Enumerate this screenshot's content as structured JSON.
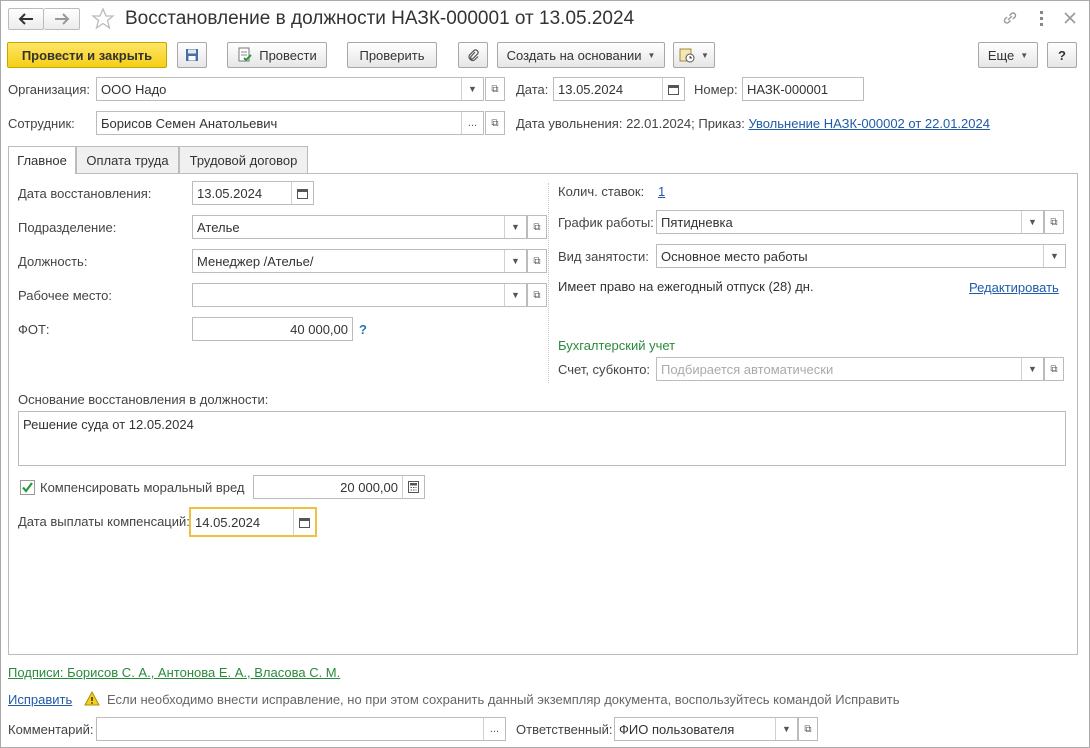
{
  "title": "Восстановление в должности НАЗК-000001 от 13.05.2024",
  "toolbar": {
    "post_close": "Провести и закрыть",
    "post": "Провести",
    "check": "Проверить",
    "create_based": "Создать на основании",
    "more": "Еще",
    "help": "?"
  },
  "header": {
    "org_label": "Организация:",
    "org_value": "ООО Надо",
    "date_label": "Дата:",
    "date_value": "13.05.2024",
    "number_label": "Номер:",
    "number_value": "НАЗК-000001",
    "employee_label": "Сотрудник:",
    "employee_value": "Борисов Семен Анатольевич",
    "dismissal_text": "Дата увольнения: 22.01.2024; Приказ:",
    "dismissal_link": "Увольнение НАЗК-000002 от 22.01.2024"
  },
  "tabs": [
    "Главное",
    "Оплата труда",
    "Трудовой договор"
  ],
  "main": {
    "restore_date_label": "Дата восстановления:",
    "restore_date_value": "13.05.2024",
    "department_label": "Подразделение:",
    "department_value": "Ателье",
    "position_label": "Должность:",
    "position_value": "Менеджер /Ателье/",
    "workplace_label": "Рабочее место:",
    "workplace_value": "",
    "fot_label": "ФОТ:",
    "fot_value": "40 000,00",
    "fot_help": "?",
    "rates_label": "Колич. ставок:",
    "rates_value": "1",
    "schedule_label": "График работы:",
    "schedule_value": "Пятидневка",
    "employment_label": "Вид занятости:",
    "employment_value": "Основное место работы",
    "vacation_text": "Имеет право на ежегодный отпуск (28) дн.",
    "edit_link": "Редактировать",
    "accounting_header": "Бухгалтерский учет",
    "account_label": "Счет, субконто:",
    "account_placeholder": "Подбирается автоматически",
    "basis_label": "Основание восстановления в должности:",
    "basis_value": "Решение суда от 12.05.2024",
    "compensate_label": "Компенсировать моральный вред",
    "compensate_checked": true,
    "compensate_value": "20 000,00",
    "payment_date_label": "Дата выплаты компенсаций:",
    "payment_date_value": "14.05.2024"
  },
  "footer": {
    "signatures": "Подписи: Борисов С. А., Антонова Е. А., Власова С. М.",
    "fix_link": "Исправить",
    "fix_hint": "Если необходимо внести исправление, но при этом сохранить данный экземпляр документа, воспользуйтесь командой Исправить",
    "comment_label": "Комментарий:",
    "comment_value": "",
    "responsible_label": "Ответственный:",
    "responsible_value": "ФИО пользователя"
  },
  "colors": {
    "accent_yellow": "#f5cf18",
    "link_blue": "#1f5ba9",
    "green": "#2a8a3c",
    "focus": "#f0c040"
  }
}
